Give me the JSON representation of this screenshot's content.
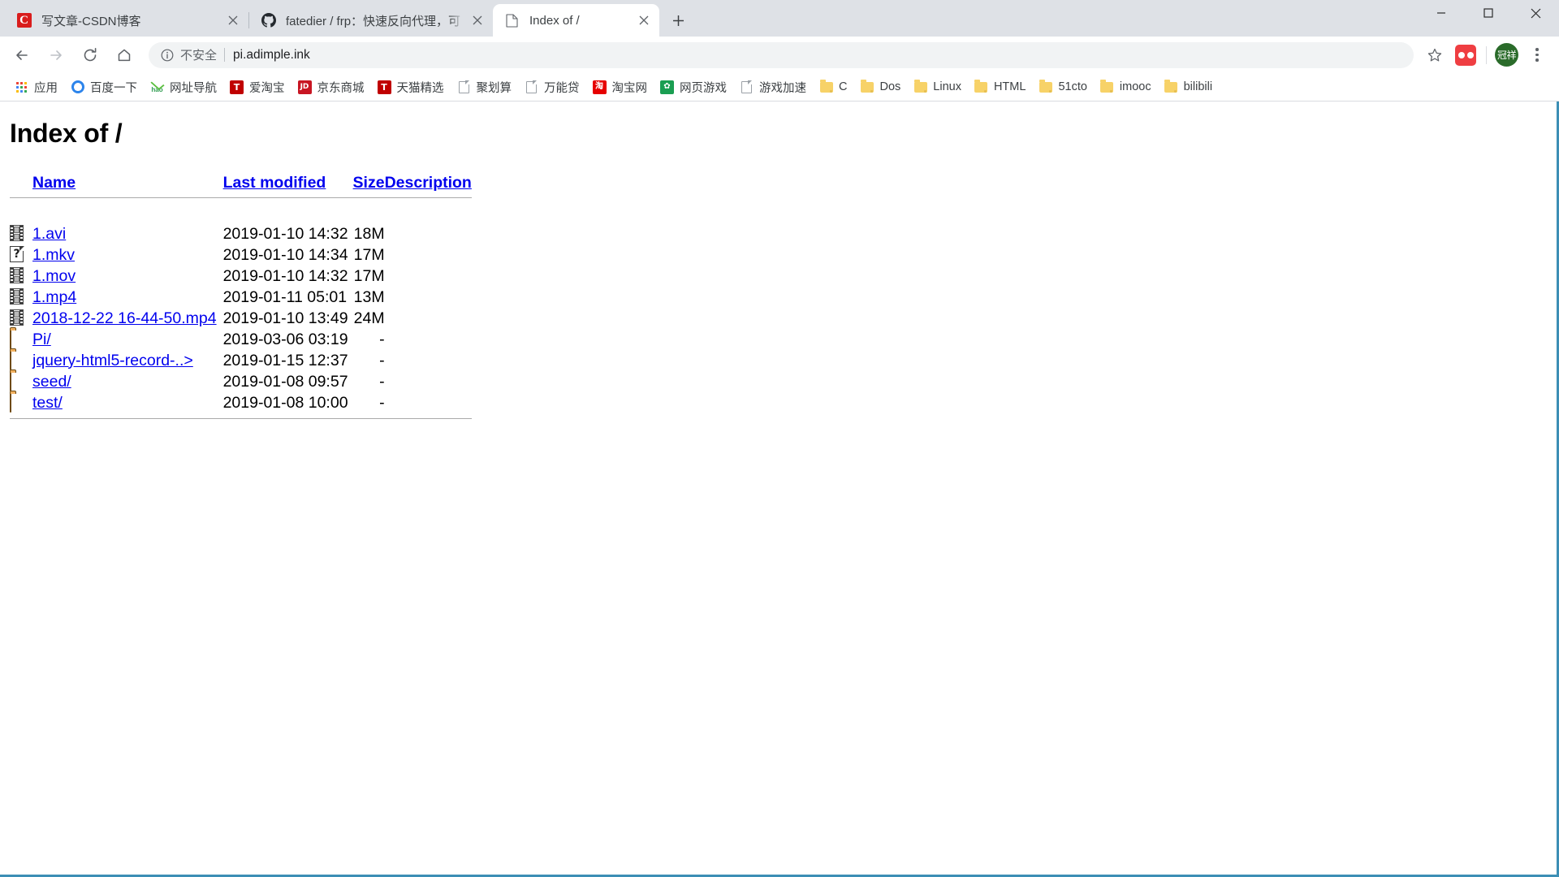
{
  "window": {
    "minimize_label": "—",
    "maximize_label": "□",
    "close_label": "✕"
  },
  "tabs": [
    {
      "title": "写文章-CSDN博客",
      "favicon": "csdn-icon",
      "active": false
    },
    {
      "title": "fatedier / frp：快速反向代理，可",
      "favicon": "github-icon",
      "active": false
    },
    {
      "title": "Index of /",
      "favicon": "page-icon",
      "active": true
    }
  ],
  "newtab": {
    "label": "+"
  },
  "toolbar": {
    "back_label": "←",
    "forward_label": "→",
    "reload_label": "⟳",
    "home_label": "⌂",
    "security_text": "不安全",
    "url": "pi.adimple.ink",
    "star_label": "☆",
    "avatar_text": "冠祥"
  },
  "bookmarks": [
    {
      "label": "应用",
      "icon": "apps-grid-icon"
    },
    {
      "label": "百度一下",
      "icon": "baidu-icon"
    },
    {
      "label": "网址导航",
      "icon": "hao123-icon"
    },
    {
      "label": "爱淘宝",
      "icon": "taobao-t-icon",
      "badge": "T"
    },
    {
      "label": "京东商城",
      "icon": "jd-icon",
      "badge": "JD"
    },
    {
      "label": "天猫精选",
      "icon": "tmall-t-icon",
      "badge": "T"
    },
    {
      "label": "聚划算",
      "icon": "page-icon"
    },
    {
      "label": "万能贷",
      "icon": "page-icon"
    },
    {
      "label": "淘宝网",
      "icon": "taobao-icon",
      "badge": "淘"
    },
    {
      "label": "网页游戏",
      "icon": "green-flower-icon",
      "badge": "✿"
    },
    {
      "label": "游戏加速",
      "icon": "page-icon"
    },
    {
      "label": "C",
      "icon": "folder-icon"
    },
    {
      "label": "Dos",
      "icon": "folder-icon"
    },
    {
      "label": "Linux",
      "icon": "folder-icon"
    },
    {
      "label": "HTML",
      "icon": "folder-icon"
    },
    {
      "label": "51cto",
      "icon": "folder-icon"
    },
    {
      "label": "imooc",
      "icon": "folder-icon"
    },
    {
      "label": "bilibili",
      "icon": "folder-icon"
    }
  ],
  "page": {
    "title": "Index of /",
    "columns": {
      "name": "Name",
      "last_modified": "Last modified",
      "size": "Size",
      "description": "Description"
    },
    "rows": [
      {
        "icon": "video-file-icon",
        "name": "1.avi",
        "modified": "2019-01-10 14:32",
        "size": "18M",
        "description": ""
      },
      {
        "icon": "unknown-file-icon",
        "name": "1.mkv",
        "modified": "2019-01-10 14:34",
        "size": "17M",
        "description": ""
      },
      {
        "icon": "video-file-icon",
        "name": "1.mov",
        "modified": "2019-01-10 14:32",
        "size": "17M",
        "description": ""
      },
      {
        "icon": "video-file-icon",
        "name": "1.mp4",
        "modified": "2019-01-11 05:01",
        "size": "13M",
        "description": ""
      },
      {
        "icon": "video-file-icon",
        "name": "2018-12-22 16-44-50.mp4",
        "modified": "2019-01-10 13:49",
        "size": "24M",
        "description": ""
      },
      {
        "icon": "folder-file-icon",
        "name": "Pi/",
        "modified": "2019-03-06 03:19",
        "size": "-",
        "description": ""
      },
      {
        "icon": "folder-file-icon",
        "name": "jquery-html5-record-..>",
        "modified": "2019-01-15 12:37",
        "size": "-",
        "description": ""
      },
      {
        "icon": "folder-file-icon",
        "name": "seed/",
        "modified": "2019-01-08 09:57",
        "size": "-",
        "description": ""
      },
      {
        "icon": "folder-file-icon",
        "name": "test/",
        "modified": "2019-01-08 10:00",
        "size": "-",
        "description": ""
      }
    ]
  },
  "colors": {
    "link": "#0000ee",
    "chrome_tabstrip": "#dee1e6",
    "avatar_bg": "#2a6b2a",
    "accent_edge": "#3d8fb5"
  }
}
